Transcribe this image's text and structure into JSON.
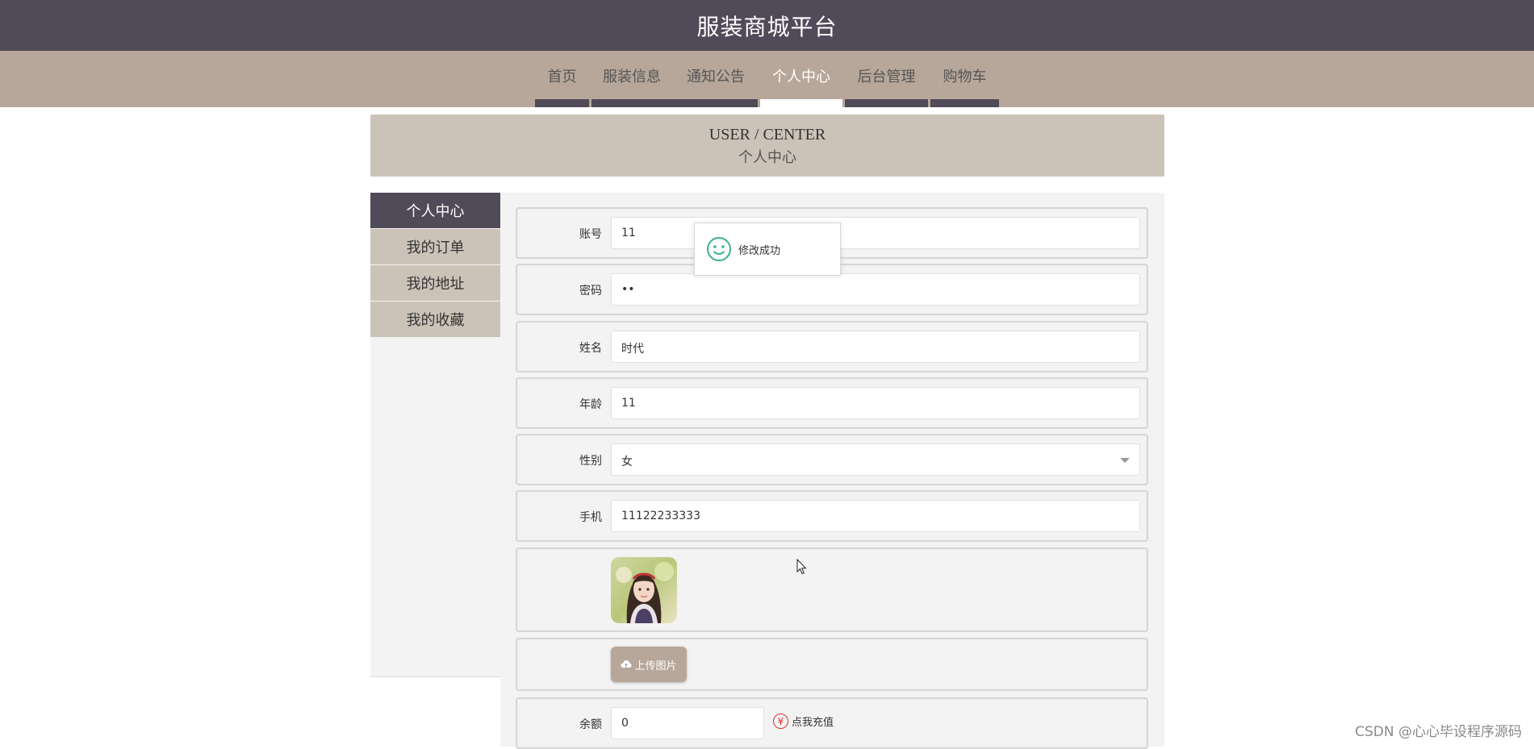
{
  "header": {
    "site_title": "服装商城平台"
  },
  "nav": {
    "items": [
      {
        "label": "首页",
        "active": false
      },
      {
        "label": "服装信息",
        "active": false
      },
      {
        "label": "通知公告",
        "active": false
      },
      {
        "label": "个人中心",
        "active": true
      },
      {
        "label": "后台管理",
        "active": false
      },
      {
        "label": "购物车",
        "active": false
      }
    ]
  },
  "banner": {
    "title_en": "USER / CENTER",
    "title_cn": "个人中心"
  },
  "sidebar": {
    "items": [
      {
        "label": "个人中心",
        "active": true
      },
      {
        "label": "我的订单",
        "active": false
      },
      {
        "label": "我的地址",
        "active": false
      },
      {
        "label": "我的收藏",
        "active": false
      }
    ]
  },
  "form": {
    "account": {
      "label": "账号",
      "value": "11"
    },
    "password": {
      "label": "密码",
      "value": "••"
    },
    "name": {
      "label": "姓名",
      "value": "时代"
    },
    "age": {
      "label": "年龄",
      "value": "11"
    },
    "gender": {
      "label": "性别",
      "value": "女"
    },
    "phone": {
      "label": "手机",
      "value": "11122233333"
    },
    "upload_label": "上传图片",
    "balance": {
      "label": "余额",
      "value": "0"
    },
    "recharge_label": "点我充值",
    "recharge_icon": "¥"
  },
  "toast": {
    "message": "修改成功"
  },
  "watermark": "CSDN @心心毕设程序源码",
  "colors": {
    "header_bg": "#514a58",
    "nav_bg": "#b7a79a",
    "banner_bg": "#ccc3b8",
    "toast_icon": "#3bb08f",
    "recharge_icon": "#d9312d"
  }
}
